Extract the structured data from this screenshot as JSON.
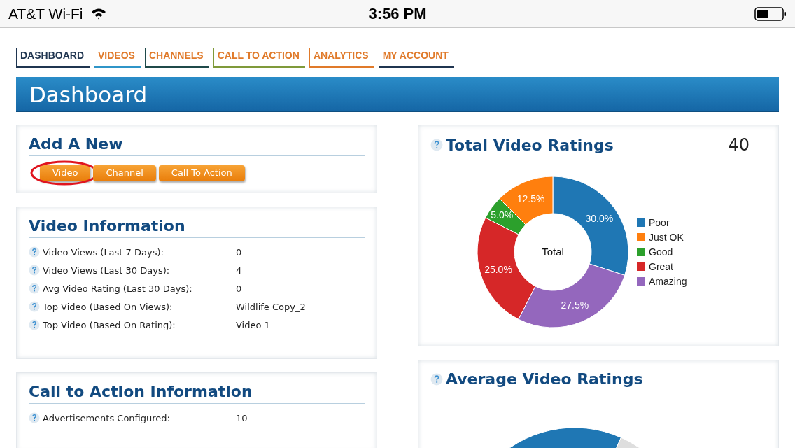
{
  "status_bar": {
    "carrier": "AT&T Wi-Fi",
    "time": "3:56 PM"
  },
  "tabs": [
    {
      "label": "DASHBOARD",
      "selected": true,
      "color": "#1f3550"
    },
    {
      "label": "VIDEOS",
      "selected": false,
      "color": "#2f95c8"
    },
    {
      "label": "CHANNELS",
      "selected": false,
      "color": "#1f4a4a"
    },
    {
      "label": "CALL TO ACTION",
      "selected": false,
      "color": "#7f9a3a"
    },
    {
      "label": "ANALYTICS",
      "selected": false,
      "color": "#e07a2a"
    },
    {
      "label": "MY ACCOUNT",
      "selected": false,
      "color": "#1f3550"
    }
  ],
  "page_title": "Dashboard",
  "add_new": {
    "title": "Add A New",
    "buttons": [
      {
        "label": "Video",
        "circled": true
      },
      {
        "label": "Channel",
        "circled": false
      },
      {
        "label": "Call To Action",
        "circled": false
      }
    ]
  },
  "video_information": {
    "title": "Video Information",
    "rows": [
      {
        "label": "Video Views (Last 7 Days):",
        "value": "0"
      },
      {
        "label": "Video Views (Last 30 Days):",
        "value": "4"
      },
      {
        "label": "Avg Video Rating (Last 30 Days):",
        "value": "0"
      },
      {
        "label": "Top Video (Based On Views):",
        "value": "Wildlife Copy_2"
      },
      {
        "label": "Top Video (Based On Rating):",
        "value": "Video 1"
      }
    ]
  },
  "call_to_action_information": {
    "title": "Call to Action Information",
    "rows": [
      {
        "label": "Advertisements Configured:",
        "value": "10"
      }
    ]
  },
  "total_video_ratings": {
    "title": "Total Video Ratings",
    "count": "40",
    "center_label": "Total",
    "chart_data": {
      "type": "donut",
      "categories": [
        "Poor",
        "Just OK",
        "Good",
        "Great",
        "Amazing"
      ],
      "series": [
        {
          "values": [
            30.0,
            12.5,
            5.0,
            25.0,
            27.5
          ]
        }
      ],
      "colors": [
        "#1f77b4",
        "#ff7f0e",
        "#2ca02c",
        "#d62728",
        "#9467bd"
      ],
      "value_labels": [
        "30.0%",
        "12.5%",
        "5.0%",
        "25.0%",
        "27.5%"
      ]
    }
  },
  "average_video_ratings": {
    "title": "Average Video Ratings"
  }
}
